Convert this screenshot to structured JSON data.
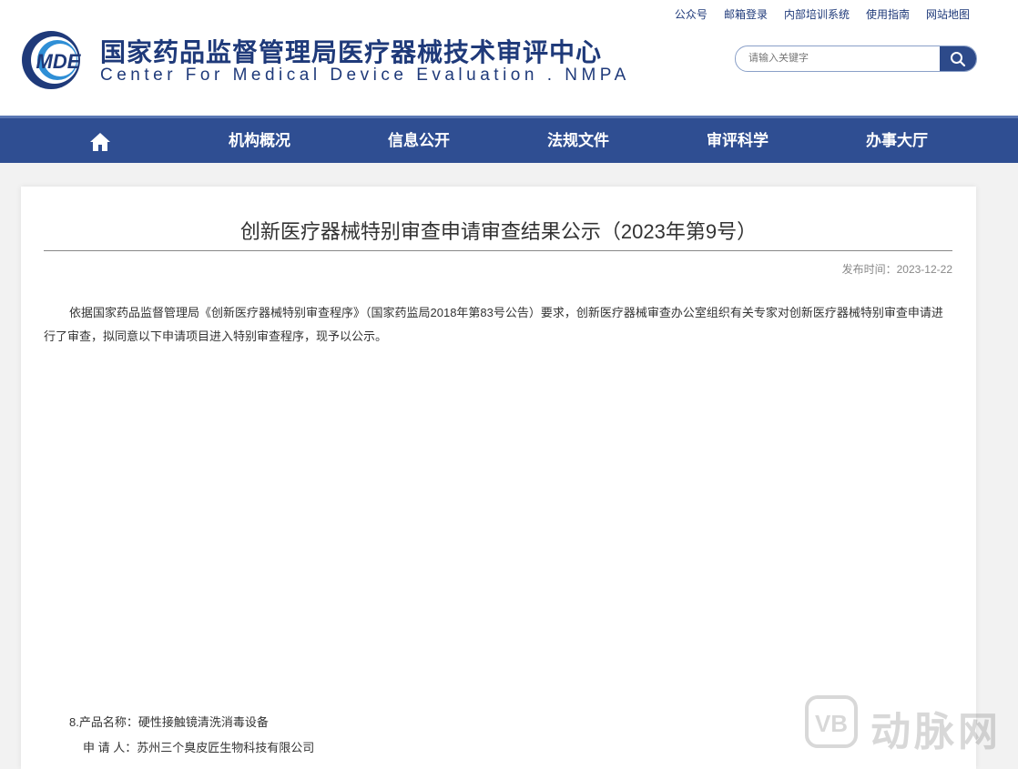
{
  "header": {
    "toplinks": [
      "公众号",
      "邮箱登录",
      "内部培训系统",
      "使用指南",
      "网站地图"
    ],
    "logo_text": "MDE",
    "title_cn": "国家药品监督管理局医疗器械技术审评中心",
    "title_en": "Center For Medical Device Evaluation . NMPA",
    "search_placeholder": "请输入关键字"
  },
  "nav": {
    "items": [
      "机构概况",
      "信息公开",
      "法规文件",
      "审评科学",
      "办事大厅"
    ]
  },
  "article": {
    "title": "创新医疗器械特别审查申请审查结果公示（2023年第9号）",
    "pubdate": "发布时间：2023-12-22",
    "body": "依据国家药品监督管理局《创新医疗器械特别审查程序》（国家药监局2018年第83号公告）要求，创新医疗器械审查办公室组织有关专家对创新医疗器械特别审查申请进行了审查，拟同意以下申请项目进入特别审查程序，现予以公示。",
    "item_product": "8.产品名称：硬性接触镜清洗消毒设备",
    "item_applicant": "申 请 人：苏州三个臭皮匠生物科技有限公司"
  },
  "watermark": {
    "text": "动脉网",
    "logo": "VB"
  },
  "colors": {
    "brand": "#1f3a7a",
    "nav_bg": "#2f4e92",
    "search_btn": "#2d4a8a"
  }
}
